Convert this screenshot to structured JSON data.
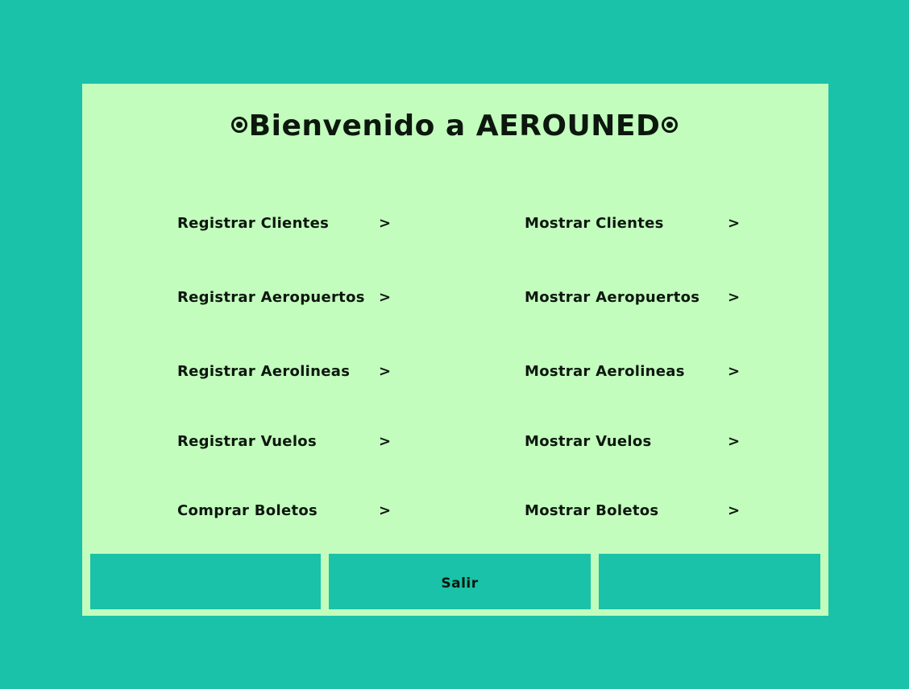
{
  "app": {
    "title": "Bienvenido a AEROUNED"
  },
  "menu": {
    "left": [
      {
        "label": "Registrar Clientes",
        "arrow": ">"
      },
      {
        "label": "Registrar Aeropuertos",
        "arrow": ">"
      },
      {
        "label": "Registrar Aerolineas",
        "arrow": ">"
      },
      {
        "label": "Registrar Vuelos",
        "arrow": ">"
      },
      {
        "label": "Comprar Boletos",
        "arrow": ">"
      }
    ],
    "right": [
      {
        "label": "Mostrar Clientes",
        "arrow": ">"
      },
      {
        "label": "Mostrar Aeropuertos",
        "arrow": ">"
      },
      {
        "label": "Mostrar Aerolineas",
        "arrow": ">"
      },
      {
        "label": "Mostrar Vuelos",
        "arrow": ">"
      },
      {
        "label": "Mostrar Boletos",
        "arrow": ">"
      }
    ]
  },
  "footer": {
    "exit_label": "Salir"
  },
  "colors": {
    "background": "#19c2a8",
    "panel": "#c3fdbe",
    "text": "#0c170d"
  },
  "icons": {
    "title_ornament": "bullseye-icon"
  }
}
